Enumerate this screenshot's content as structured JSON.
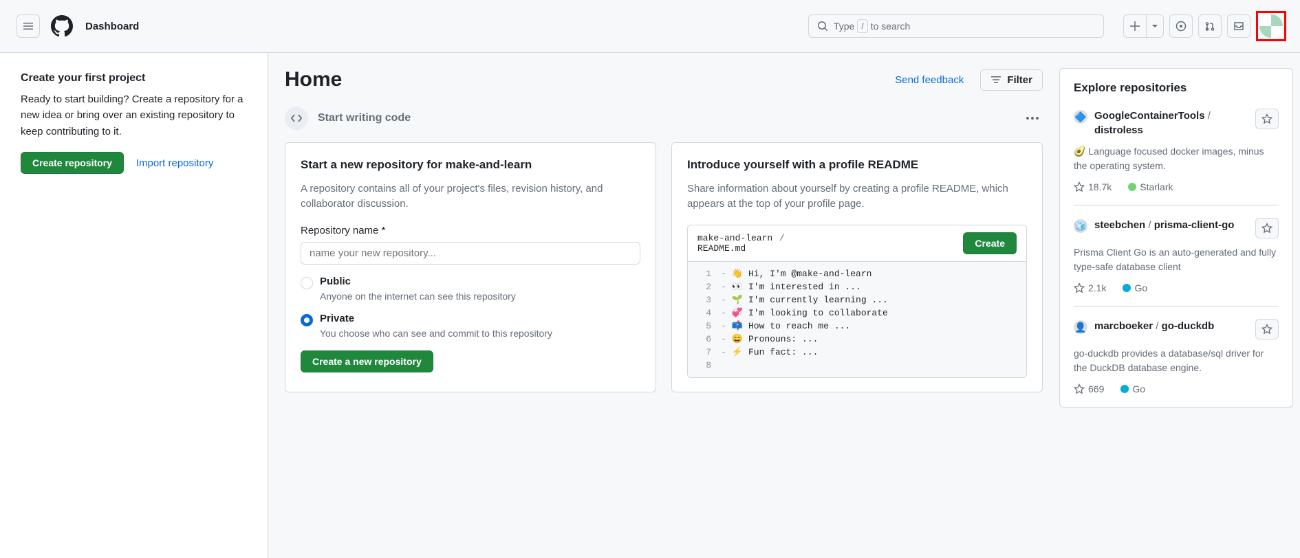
{
  "header": {
    "dashboard": "Dashboard",
    "search_prefix": "Type",
    "search_key": "/",
    "search_suffix": "to search"
  },
  "sidebar": {
    "title": "Create your first project",
    "desc": "Ready to start building? Create a repository for a new idea or bring over an existing repository to keep contributing to it.",
    "create_btn": "Create repository",
    "import_link": "Import repository"
  },
  "content": {
    "title": "Home",
    "feedback": "Send feedback",
    "filter": "Filter",
    "section_label": "Start writing code"
  },
  "new_repo": {
    "title": "Start a new repository for make-and-learn",
    "desc": "A repository contains all of your project's files, revision history, and collaborator discussion.",
    "field_label": "Repository name *",
    "placeholder": "name your new repository...",
    "public_label": "Public",
    "public_desc": "Anyone on the internet can see this repository",
    "private_label": "Private",
    "private_desc": "You choose who can see and commit to this repository",
    "create_btn": "Create a new repository"
  },
  "readme": {
    "title": "Introduce yourself with a profile README",
    "desc": "Share information about yourself by creating a profile README, which appears at the top of your profile page.",
    "owner": "make-and-learn",
    "file": "README.md",
    "create_btn": "Create",
    "lines": [
      {
        "n": "1",
        "e": "👋",
        "t": "Hi, I'm @make-and-learn"
      },
      {
        "n": "2",
        "e": "👀",
        "t": "I'm interested in ..."
      },
      {
        "n": "3",
        "e": "🌱",
        "t": "I'm currently learning ..."
      },
      {
        "n": "4",
        "e": "💞️",
        "t": "I'm looking to collaborate"
      },
      {
        "n": "5",
        "e": "📫",
        "t": "How to reach me ..."
      },
      {
        "n": "6",
        "e": "😄",
        "t": "Pronouns: ..."
      },
      {
        "n": "7",
        "e": "⚡",
        "t": "Fun fact: ..."
      },
      {
        "n": "8",
        "e": "",
        "t": ""
      }
    ]
  },
  "explore": {
    "title": "Explore repositories",
    "repos": [
      {
        "avatar": "🔷",
        "owner": "GoogleContainerTools",
        "name": "distroless",
        "desc": "🥑 Language focused docker images, minus the operating system.",
        "stars": "18.7k",
        "lang": "Starlark",
        "lang_color": "#76d275"
      },
      {
        "avatar": "🧊",
        "owner": "steebchen",
        "name": "prisma-client-go",
        "desc": "Prisma Client Go is an auto-generated and fully type-safe database client",
        "stars": "2.1k",
        "lang": "Go",
        "lang_color": "#00ADD8"
      },
      {
        "avatar": "👤",
        "owner": "marcboeker",
        "name": "go-duckdb",
        "desc": "go-duckdb provides a database/sql driver for the DuckDB database engine.",
        "stars": "669",
        "lang": "Go",
        "lang_color": "#00ADD8"
      }
    ]
  }
}
